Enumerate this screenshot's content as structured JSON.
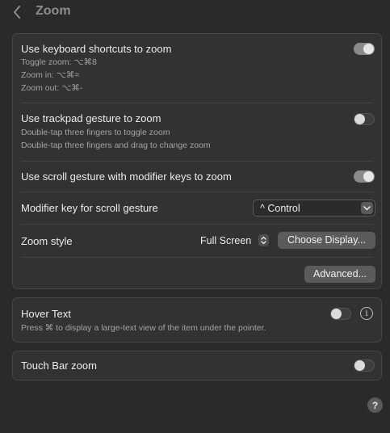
{
  "header": {
    "title": "Zoom"
  },
  "zoom_group": {
    "keyboard": {
      "label": "Use keyboard shortcuts to zoom",
      "toggle_on": true,
      "lines": [
        "Toggle zoom: ⌥⌘8",
        "Zoom in: ⌥⌘=",
        "Zoom out: ⌥⌘-"
      ]
    },
    "trackpad": {
      "label": "Use trackpad gesture to zoom",
      "toggle_on": false,
      "lines": [
        "Double-tap three fingers to toggle zoom",
        "Double-tap three fingers and drag to change zoom"
      ]
    },
    "scroll": {
      "label": "Use scroll gesture with modifier keys to zoom",
      "toggle_on": true
    },
    "modifier": {
      "label": "Modifier key for scroll gesture",
      "value": "^ Control"
    },
    "style": {
      "label": "Zoom style",
      "value": "Full Screen",
      "choose_button": "Choose Display..."
    },
    "advanced_button": "Advanced..."
  },
  "hover_group": {
    "label": "Hover Text",
    "toggle_on": false,
    "description": "Press ⌘ to display a large-text view of the item under the pointer.",
    "info_glyph": "i"
  },
  "touchbar_group": {
    "label": "Touch Bar zoom",
    "toggle_on": false
  },
  "help_glyph": "?"
}
